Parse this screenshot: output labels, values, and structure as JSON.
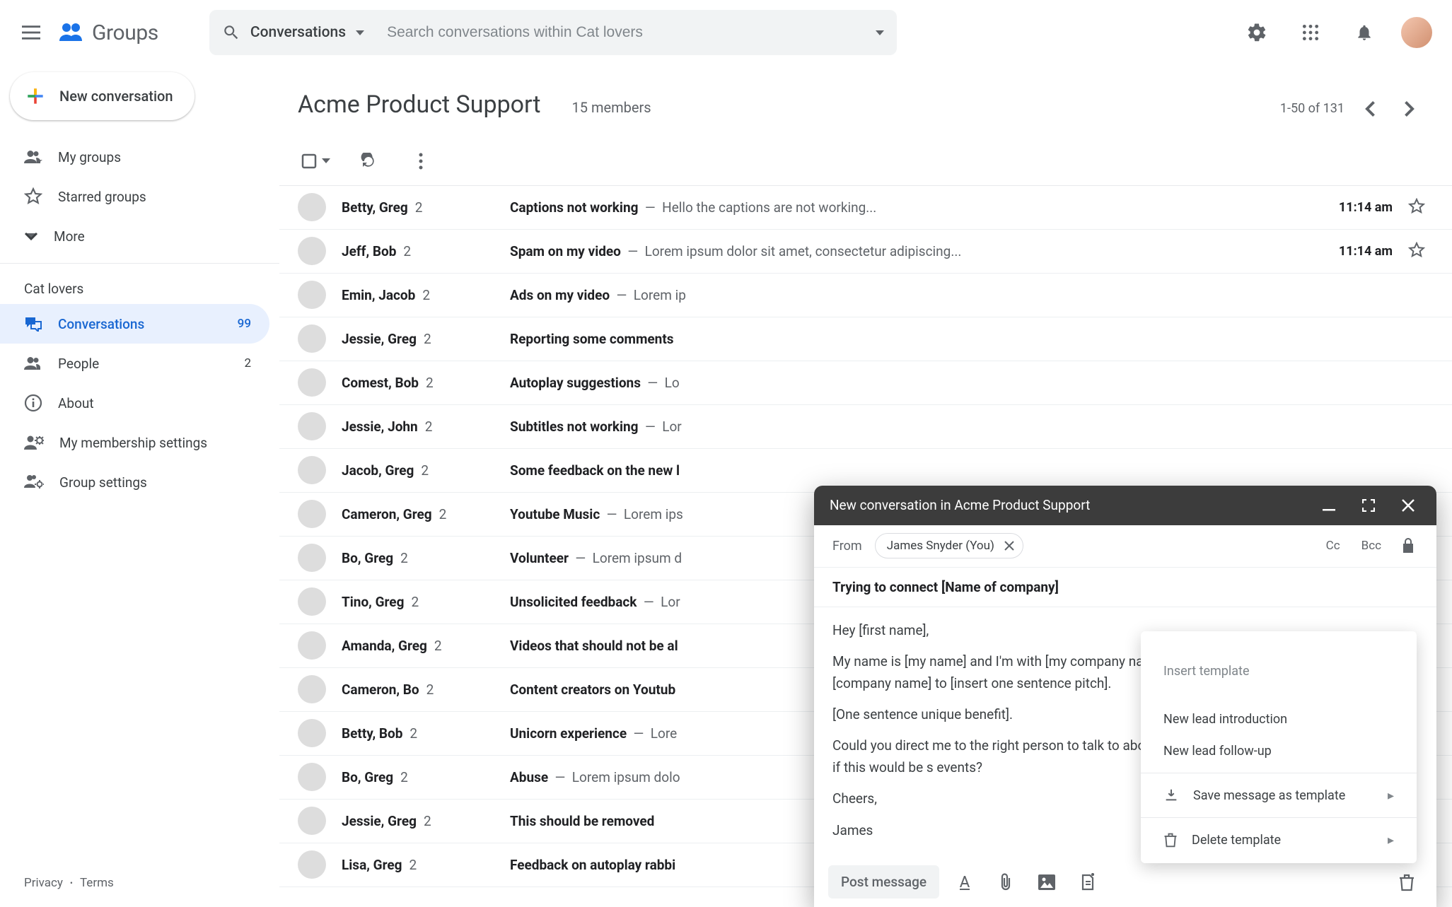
{
  "header": {
    "product": "Groups",
    "search_dropdown_label": "Conversations",
    "search_placeholder": "Search conversations within Cat lovers"
  },
  "sidebar": {
    "compose_label": "New conversation",
    "primary": [
      {
        "label": "My groups"
      },
      {
        "label": "Starred groups"
      },
      {
        "label": "More"
      }
    ],
    "section_label": "Cat lovers",
    "group_items": [
      {
        "label": "Conversations",
        "count": "99",
        "selected": true
      },
      {
        "label": "People",
        "count": "2"
      },
      {
        "label": "About"
      },
      {
        "label": "My membership settings"
      },
      {
        "label": "Group settings"
      }
    ],
    "footer": {
      "privacy": "Privacy",
      "terms": "Terms"
    }
  },
  "main": {
    "title": "Acme Product Support",
    "members": "15 members",
    "pager": "1-50 of 131"
  },
  "messages": [
    {
      "senders": "Betty, Greg",
      "count": "2",
      "subject": "Captions not working",
      "snippet": "Hello the captions are not working...",
      "time": "11:14 am",
      "av": "av1"
    },
    {
      "senders": "Jeff, Bob",
      "count": "2",
      "subject": "Spam on my video",
      "snippet": "Lorem ipsum dolor sit amet, consectetur adipiscing...",
      "time": "11:14 am",
      "av": "av2"
    },
    {
      "senders": "Emin, Jacob",
      "count": "2",
      "subject": "Ads on my video",
      "snippet": "Lorem ip",
      "time": "",
      "av": "av3"
    },
    {
      "senders": "Jessie, Greg",
      "count": "2",
      "subject": "Reporting some comments",
      "snippet": "",
      "time": "",
      "av": "av4"
    },
    {
      "senders": "Comest, Bob",
      "count": "2",
      "subject": "Autoplay suggestions",
      "snippet": "Lo",
      "time": "",
      "av": "av5"
    },
    {
      "senders": "Jessie, John",
      "count": "2",
      "subject": "Subtitles not working",
      "snippet": "Lor",
      "time": "",
      "av": "av6"
    },
    {
      "senders": "Jacob, Greg",
      "count": "2",
      "subject": "Some feedback on the new l",
      "snippet": "",
      "time": "",
      "av": "av7"
    },
    {
      "senders": "Cameron, Greg",
      "count": "2",
      "subject": "Youtube Music",
      "snippet": "Lorem ips",
      "time": "",
      "av": "av8"
    },
    {
      "senders": "Bo, Greg",
      "count": "2",
      "subject": "Volunteer",
      "snippet": "Lorem ipsum d",
      "time": "",
      "av": "av9"
    },
    {
      "senders": "Tino, Greg",
      "count": "2",
      "subject": "Unsolicited feedback",
      "snippet": "Lor",
      "time": "",
      "av": "av5"
    },
    {
      "senders": "Amanda, Greg",
      "count": "2",
      "subject": "Videos that should not be al",
      "snippet": "",
      "time": "",
      "av": "av9"
    },
    {
      "senders": "Cameron, Bo",
      "count": "2",
      "subject": "Content creators on Youtub",
      "snippet": "",
      "time": "",
      "av": "av3"
    },
    {
      "senders": "Betty, Bob",
      "count": "2",
      "subject": "Unicorn experience",
      "snippet": "Lore",
      "time": "",
      "av": "av8"
    },
    {
      "senders": "Bo, Greg",
      "count": "2",
      "subject": "Abuse",
      "snippet": "Lorem ipsum dolo",
      "time": "",
      "av": "av9"
    },
    {
      "senders": "Jessie, Greg",
      "count": "2",
      "subject": "This should be removed",
      "snippet": "",
      "time": "",
      "av": "av4"
    },
    {
      "senders": "Lisa, Greg",
      "count": "2",
      "subject": "Feedback on autoplay rabbi",
      "snippet": "",
      "time": "",
      "av": "av3"
    }
  ],
  "compose": {
    "title": "New conversation in Acme Product Support",
    "from_label": "From",
    "from_chip": "James Snyder (You)",
    "cc": "Cc",
    "bcc": "Bcc",
    "subject": "Trying to connect [Name of company]",
    "body": [
      "Hey [first name],",
      "My name is [my name] and I'm with [my company name]. We work with organizations like [company name] to [insert one sentence pitch].",
      "[One sentence unique benefit].",
      "Could you direct me to the right person to talk to about this at [company name] so we can explore if this would be s events?",
      "Cheers,",
      "James"
    ],
    "post_label": "Post message"
  },
  "template_menu": {
    "header": "Insert template",
    "items": [
      "New lead introduction",
      "New lead follow-up"
    ],
    "save": "Save message as template",
    "delete": "Delete template"
  }
}
